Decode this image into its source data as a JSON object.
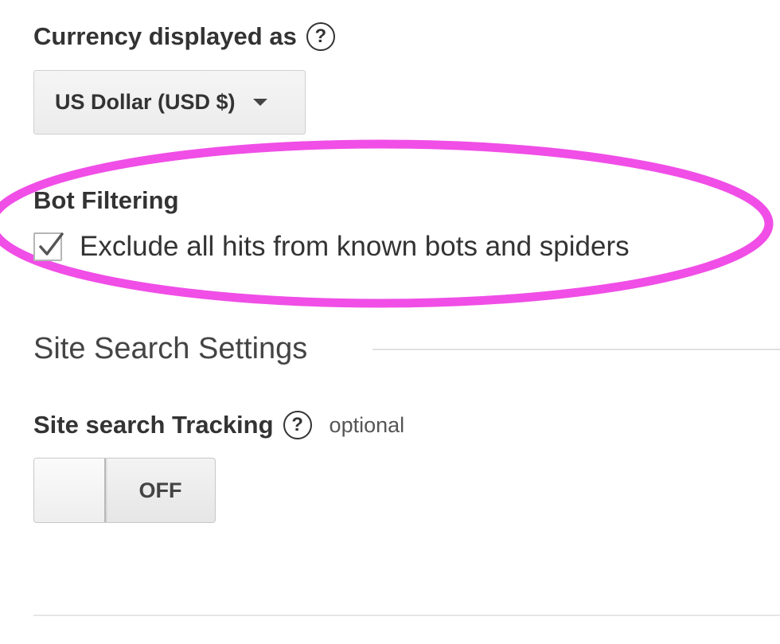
{
  "currency": {
    "label": "Currency displayed as",
    "help_glyph": "?",
    "selected": "US Dollar (USD $)"
  },
  "bot_filtering": {
    "heading": "Bot Filtering",
    "checkbox_label": "Exclude all hits from known bots and spiders",
    "checked": true,
    "highlight_color": "#f04ee6"
  },
  "site_search": {
    "heading": "Site Search Settings",
    "tracking_label": "Site search Tracking",
    "help_glyph": "?",
    "optional": "optional",
    "toggle_state": "OFF"
  },
  "icons": [
    "help-icon",
    "chevron-down-icon",
    "checkmark-icon"
  ]
}
